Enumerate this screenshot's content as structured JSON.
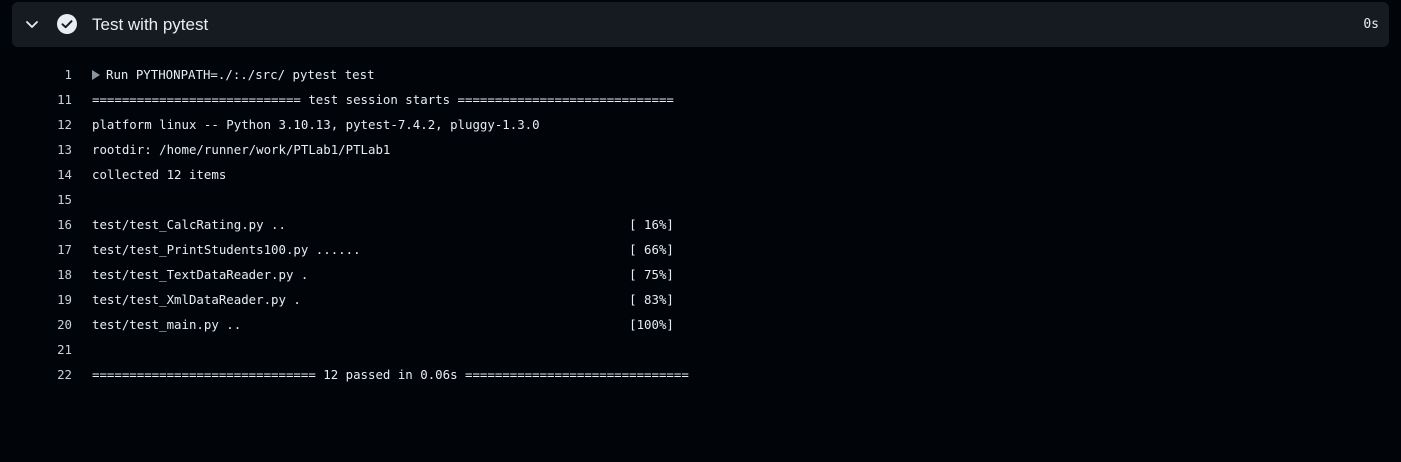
{
  "step": {
    "title": "Test with pytest",
    "duration": "0s",
    "status_icon": "check-circle-icon",
    "toggle_icon": "chevron-down-icon"
  },
  "colors": {
    "background": "#010409",
    "header_bg": "#161b22",
    "text": "#e6edf3",
    "muted": "#8b949e"
  },
  "log": {
    "lines": [
      {
        "no": "1",
        "text": "Run PYTHONPATH=./:./src/ pytest test",
        "expandable": true
      },
      {
        "no": "11",
        "text": "============================ test session starts ============================="
      },
      {
        "no": "12",
        "text": "platform linux -- Python 3.10.13, pytest-7.4.2, pluggy-1.3.0"
      },
      {
        "no": "13",
        "text": "rootdir: /home/runner/work/PTLab1/PTLab1"
      },
      {
        "no": "14",
        "text": "collected 12 items"
      },
      {
        "no": "15",
        "text": ""
      },
      {
        "no": "16",
        "text": "test/test_CalcRating.py ..                                              [ 16%]"
      },
      {
        "no": "17",
        "text": "test/test_PrintStudents100.py ......                                    [ 66%]"
      },
      {
        "no": "18",
        "text": "test/test_TextDataReader.py .                                           [ 75%]"
      },
      {
        "no": "19",
        "text": "test/test_XmlDataReader.py .                                            [ 83%]"
      },
      {
        "no": "20",
        "text": "test/test_main.py ..                                                    [100%]"
      },
      {
        "no": "21",
        "text": ""
      },
      {
        "no": "22",
        "text": "============================== 12 passed in 0.06s =============================="
      }
    ]
  }
}
